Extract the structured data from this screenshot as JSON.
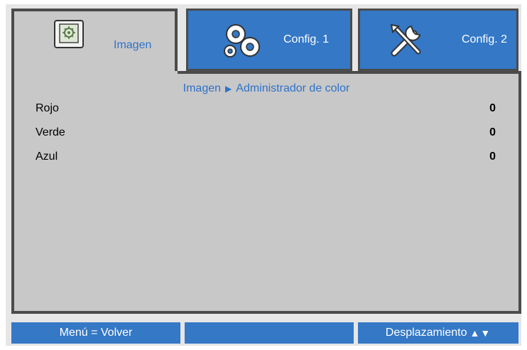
{
  "tabs": [
    {
      "label": "Imagen",
      "icon": "image-settings-icon",
      "active": true
    },
    {
      "label": "Config. 1",
      "icon": "gears-icon",
      "active": false
    },
    {
      "label": "Config. 2",
      "icon": "tools-icon",
      "active": false
    }
  ],
  "breadcrumb": {
    "section": "Imagen",
    "separator_icon": "triangle-right-icon",
    "page": "Administrador de color"
  },
  "rows": [
    {
      "label": "Rojo",
      "value": "0"
    },
    {
      "label": "Verde",
      "value": "0"
    },
    {
      "label": "Azul",
      "value": "0"
    }
  ],
  "footer": {
    "left": "Menú = Volver",
    "middle": "",
    "right": "Desplazamiento",
    "right_icons": "▲▼"
  },
  "colors": {
    "accent_blue": "#3478c6",
    "panel_gray": "#c8c8c8",
    "border_dark": "#4b4b4b",
    "active_text": "#2f72c8"
  }
}
